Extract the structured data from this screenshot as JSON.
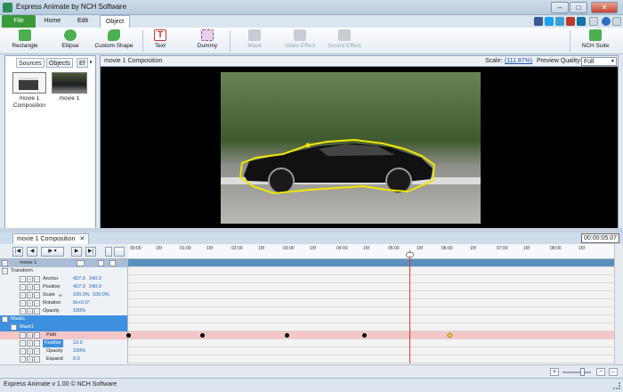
{
  "app": {
    "title": "Express Animate by NCH Software",
    "status": "Express Animate v 1.00 © NCH Software"
  },
  "ribbon": {
    "tabs": [
      "File",
      "Home",
      "Edit",
      "Object"
    ],
    "tools": {
      "rectangle": "Rectangle",
      "ellipse": "Ellipse",
      "custom_shape": "Custom Shape",
      "text": "Text",
      "dummy": "Dummy",
      "mask": "Mask",
      "video_effect": "Video Effect",
      "sound_effect": "Sound Effect",
      "nch_suite": "NCH Suite"
    }
  },
  "left_panel": {
    "tabs": [
      "Sources",
      "Objects",
      "Ef"
    ],
    "items": [
      {
        "label_line1": "movie 1",
        "label_line2": "Composition"
      },
      {
        "label_line1": "movie 1",
        "label_line2": ""
      }
    ]
  },
  "viewer": {
    "title": "movie 1 Composition",
    "scale_label": "Scale:",
    "scale_value": "(111.87%)",
    "quality_label": "Preview Quality:",
    "quality_value": "Full"
  },
  "timeline": {
    "tab": "movie 1 Composition",
    "timecode": "00:00:05.07",
    "ruler": [
      "00:00",
      "15f",
      "01:00",
      "15f",
      "02:00",
      "15f",
      "03:00",
      "15f",
      "04:00",
      "15f",
      "05:00",
      "15f",
      "06:00",
      "15f",
      "07:00",
      "15f",
      "08:00",
      "15f"
    ],
    "layer": "movie 1",
    "rows": {
      "transform": "Transform",
      "anchor": {
        "name": "Anchor",
        "v1": "427.0",
        "v2": "240.0"
      },
      "position": {
        "name": "Position",
        "v1": "427.0",
        "v2": "240.0"
      },
      "scale": {
        "name": "Scale",
        "v1": "100.0%",
        "v2": "100.0%"
      },
      "rotation": {
        "name": "Rotation",
        "v1": "0x+0.0°"
      },
      "opacity": {
        "name": "Opacity",
        "v1": "100%"
      },
      "masks": "Masks",
      "mask1": "Mask1",
      "path": {
        "name": "Path"
      },
      "feather": {
        "name": "Feather",
        "v1": "12.0"
      },
      "mask_opacity": {
        "name": "Opacity",
        "v1": "100%"
      },
      "expand": {
        "name": "Expand",
        "v1": "0.0"
      }
    }
  },
  "colors": {
    "accent_green": "#3a9a3a",
    "selection_blue": "#3d8fe0",
    "path_row": "#f4c6c6",
    "playhead": "#e23a2a",
    "mask_outline": "#f2e600"
  }
}
